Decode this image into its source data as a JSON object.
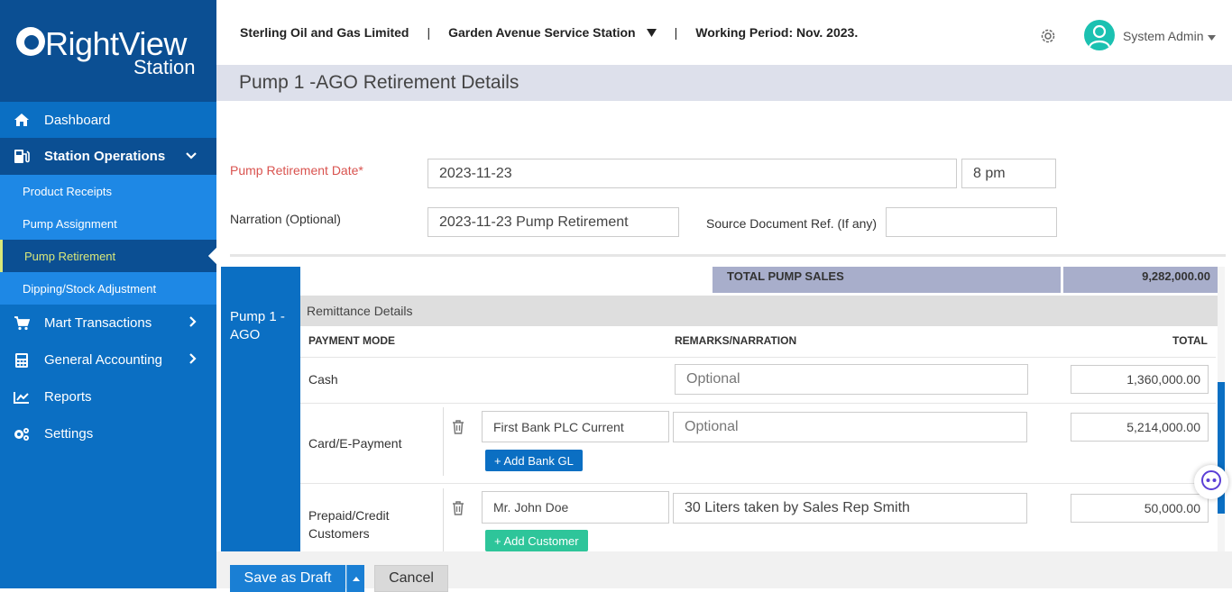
{
  "brand": {
    "name": "RightView",
    "sub": "Station"
  },
  "nav": {
    "dashboard": "Dashboard",
    "station_operations": "Station Operations",
    "sub_items": [
      "Product Receipts",
      "Pump Assignment",
      "Pump Retirement",
      "Dipping/Stock Adjustment"
    ],
    "mart_transactions": "Mart Transactions",
    "general_accounting": "General Accounting",
    "reports": "Reports",
    "settings": "Settings"
  },
  "topbar": {
    "company": "Sterling Oil and Gas Limited",
    "station": "Garden Avenue Service Station",
    "period": "Working Period: Nov. 2023.",
    "user": "System Admin"
  },
  "page_title": "Pump 1 -AGO Retirement Details",
  "form": {
    "date_label": "Pump Retirement Date*",
    "date_value": "2023-11-23",
    "time_value": "8 pm",
    "narration_label": "Narration (Optional)",
    "narration_value": "2023-11-23 Pump Retirement",
    "source_label": "Source Document Ref. (If any)",
    "source_value": ""
  },
  "pump": {
    "name_line1": "Pump 1 -",
    "name_line2": "AGO",
    "total_label": "TOTAL PUMP SALES",
    "total_value": "9,282,000.00",
    "remittance_header": "Remittance Details",
    "columns": {
      "mode": "PAYMENT MODE",
      "remarks": "REMARKS/NARRATION",
      "total": "TOTAL"
    },
    "rows": {
      "cash": {
        "label": "Cash",
        "remarks_placeholder": "Optional",
        "total": "1,360,000.00"
      },
      "card": {
        "label": "Card/E-Payment",
        "account": "First Bank PLC Current",
        "remarks_placeholder": "Optional",
        "total": "5,214,000.00",
        "add_label": "+ Add Bank GL"
      },
      "prepaid": {
        "label_line1": "Prepaid/Credit",
        "label_line2": "Customers",
        "customer": "Mr. John Doe",
        "remarks": "30  Liters taken by Sales Rep Smith",
        "total": "50,000.00",
        "add_label": "+ Add Customer"
      }
    }
  },
  "footer": {
    "save_draft": "Save as Draft",
    "cancel": "Cancel"
  }
}
